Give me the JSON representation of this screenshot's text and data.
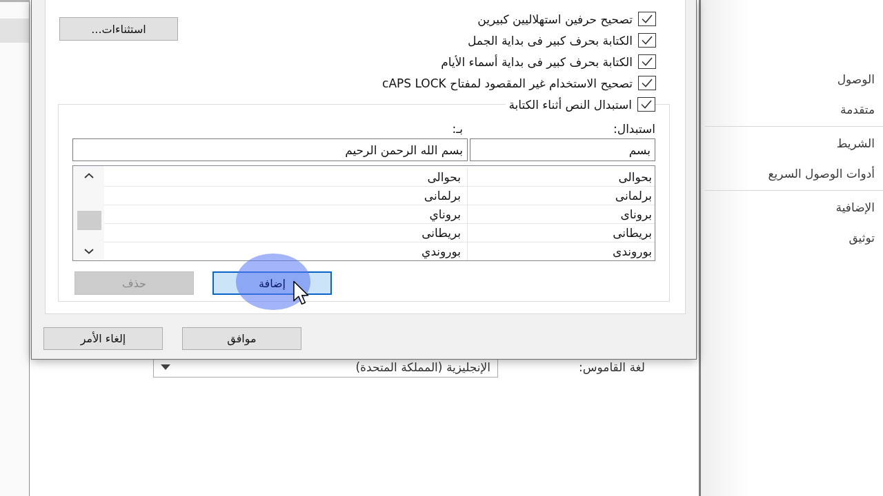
{
  "window": {
    "sidebar": {
      "groups": [
        {
          "items": [
            {
              "label": "الوصول",
              "selected": false
            },
            {
              "label": "متقدمة",
              "selected": false
            }
          ]
        },
        {
          "items": [
            {
              "label": "الشريط",
              "selected": false
            },
            {
              "label": "أدوات الوصول السريع",
              "selected": false
            }
          ]
        },
        {
          "items": [
            {
              "label": "الإضافية",
              "selected": false
            },
            {
              "label": "توثيق",
              "selected": false
            }
          ]
        }
      ]
    },
    "dictionary_language": {
      "label": "لغة القاموس:",
      "value": "الإنجليزية (المملكة المتحدة)"
    }
  },
  "dialog": {
    "exceptions_button": "استثناءات...",
    "options": [
      {
        "label": "تصحيح حرفين استهلاليين كبيرين",
        "checked": true
      },
      {
        "label": "الكتابة بحرف كبير فى بداية الجمل",
        "checked": true
      },
      {
        "label": "الكتابة بحرف كبير فى بداية أسماء الأيام",
        "checked": true
      },
      {
        "label": "تصحيح الاستخدام غير المقصود لمفتاح cAPS LOCK",
        "checked": true
      }
    ],
    "replace_group": {
      "label": "استبدال النص أثناء الكتابة",
      "checked": true,
      "replace_label": "استبدال:",
      "with_label": "بـ:",
      "replace_value": "بسم",
      "with_value": "بسم الله الرحمن الرحيم",
      "rows": [
        {
          "replace": "بحوالى",
          "with": "بحوالى"
        },
        {
          "replace": "برلمانى",
          "with": "برلمانى"
        },
        {
          "replace": "بروناى",
          "with": "بروناي"
        },
        {
          "replace": "بريطانى",
          "with": "بريطانى"
        },
        {
          "replace": "بوروندى",
          "with": "بوروندي"
        }
      ],
      "add_button": {
        "label": "إضافة",
        "focused": true
      },
      "delete_button": {
        "label": "حذف",
        "disabled": true
      }
    },
    "ok_button": "موافق",
    "cancel_button": "إلغاء الأمر"
  }
}
